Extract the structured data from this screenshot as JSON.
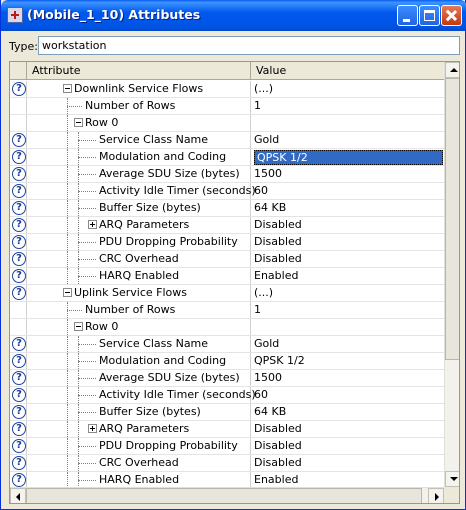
{
  "window": {
    "title": "(Mobile_1_10) Attributes",
    "controls": {
      "minimize": "minimize-icon",
      "maximize": "maximize-icon",
      "close": "close-icon"
    }
  },
  "type_field": {
    "label": "Type:",
    "value": "workstation"
  },
  "grid": {
    "headers": {
      "attribute": "Attribute",
      "value": "Value"
    },
    "help_glyph": "?",
    "rows": [
      {
        "label": "Downlink Service Flows",
        "value": "(...)",
        "level": 0,
        "toggle": "minus",
        "help": true
      },
      {
        "label": "Number of Rows",
        "value": "1",
        "level": 1,
        "toggle": "none",
        "help": false
      },
      {
        "label": "Row 0",
        "value": "",
        "level": 1,
        "toggle": "minus",
        "help": false
      },
      {
        "label": "Service Class Name",
        "value": "Gold",
        "level": 2,
        "toggle": "none",
        "help": true
      },
      {
        "label": "Modulation and Coding",
        "value": "QPSK 1/2",
        "level": 2,
        "toggle": "none",
        "help": true,
        "selected": true
      },
      {
        "label": "Average SDU Size (bytes)",
        "value": "1500",
        "level": 2,
        "toggle": "none",
        "help": true
      },
      {
        "label": "Activity Idle Timer (seconds)",
        "value": "60",
        "level": 2,
        "toggle": "none",
        "help": true
      },
      {
        "label": "Buffer Size (bytes)",
        "value": "64 KB",
        "level": 2,
        "toggle": "none",
        "help": true
      },
      {
        "label": "ARQ Parameters",
        "value": "Disabled",
        "level": 2,
        "toggle": "plus",
        "help": true
      },
      {
        "label": "PDU Dropping Probability",
        "value": "Disabled",
        "level": 2,
        "toggle": "none",
        "help": true
      },
      {
        "label": "CRC Overhead",
        "value": "Disabled",
        "level": 2,
        "toggle": "none",
        "help": true
      },
      {
        "label": "HARQ Enabled",
        "value": "Enabled",
        "level": 2,
        "toggle": "none",
        "help": true
      },
      {
        "label": "Uplink Service Flows",
        "value": "(...)",
        "level": 0,
        "toggle": "minus",
        "help": true
      },
      {
        "label": "Number of Rows",
        "value": "1",
        "level": 1,
        "toggle": "none",
        "help": false
      },
      {
        "label": "Row 0",
        "value": "",
        "level": 1,
        "toggle": "minus",
        "help": false
      },
      {
        "label": "Service Class Name",
        "value": "Gold",
        "level": 2,
        "toggle": "none",
        "help": true
      },
      {
        "label": "Modulation and Coding",
        "value": "QPSK 1/2",
        "level": 2,
        "toggle": "none",
        "help": true
      },
      {
        "label": "Average SDU Size (bytes)",
        "value": "1500",
        "level": 2,
        "toggle": "none",
        "help": true
      },
      {
        "label": "Activity Idle Timer (seconds)",
        "value": "60",
        "level": 2,
        "toggle": "none",
        "help": true
      },
      {
        "label": "Buffer Size (bytes)",
        "value": "64 KB",
        "level": 2,
        "toggle": "none",
        "help": true
      },
      {
        "label": "ARQ Parameters",
        "value": "Disabled",
        "level": 2,
        "toggle": "plus",
        "help": true
      },
      {
        "label": "PDU Dropping Probability",
        "value": "Disabled",
        "level": 2,
        "toggle": "none",
        "help": true
      },
      {
        "label": "CRC Overhead",
        "value": "Disabled",
        "level": 2,
        "toggle": "none",
        "help": true
      },
      {
        "label": "HARQ Enabled",
        "value": "Enabled",
        "level": 2,
        "toggle": "none",
        "help": true
      }
    ]
  },
  "colors": {
    "title_bar": "#0054E3",
    "selection": "#316AC5",
    "help_icon": "#1C3C9A"
  }
}
